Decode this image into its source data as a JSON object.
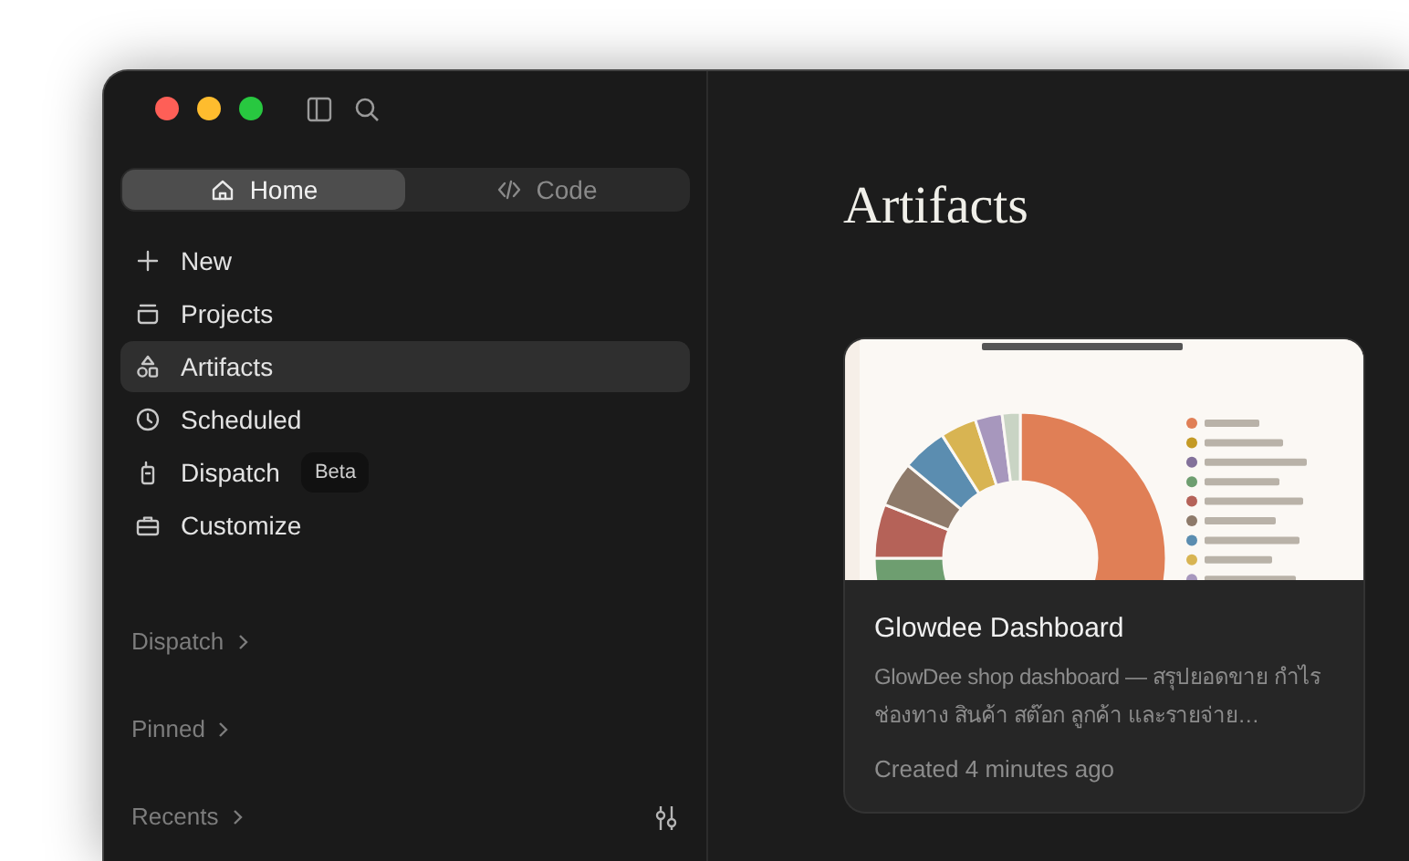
{
  "tabs": [
    {
      "label": "Home",
      "selected": true
    },
    {
      "label": "Code",
      "selected": false
    }
  ],
  "nav": [
    {
      "label": "New",
      "selected": false
    },
    {
      "label": "Projects",
      "selected": false
    },
    {
      "label": "Artifacts",
      "selected": true
    },
    {
      "label": "Scheduled",
      "selected": false
    },
    {
      "label": "Dispatch",
      "selected": false,
      "badge": "Beta"
    },
    {
      "label": "Customize",
      "selected": false
    }
  ],
  "sections": [
    {
      "label": "Dispatch",
      "kind": "plain"
    },
    {
      "label": "Pinned",
      "kind": "plain"
    },
    {
      "label": "Recents",
      "kind": "filterable"
    }
  ],
  "main": {
    "title": "Artifacts",
    "cards": [
      {
        "title": "Glowdee Dashboard",
        "description": "GlowDee shop dashboard — สรุปยอดขาย กำไร ช่องทาง สินค้า สต๊อก ลูกค้า และรายจ่าย…",
        "created": "Created 4 minutes ago"
      }
    ]
  }
}
